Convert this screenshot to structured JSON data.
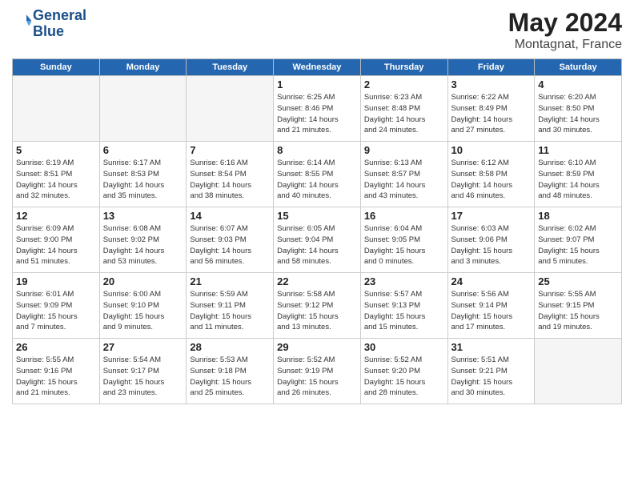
{
  "header": {
    "logo_line1": "General",
    "logo_line2": "Blue",
    "month": "May 2024",
    "location": "Montagnat, France"
  },
  "weekdays": [
    "Sunday",
    "Monday",
    "Tuesday",
    "Wednesday",
    "Thursday",
    "Friday",
    "Saturday"
  ],
  "weeks": [
    [
      {
        "day": "",
        "info": ""
      },
      {
        "day": "",
        "info": ""
      },
      {
        "day": "",
        "info": ""
      },
      {
        "day": "1",
        "info": "Sunrise: 6:25 AM\nSunset: 8:46 PM\nDaylight: 14 hours\nand 21 minutes."
      },
      {
        "day": "2",
        "info": "Sunrise: 6:23 AM\nSunset: 8:48 PM\nDaylight: 14 hours\nand 24 minutes."
      },
      {
        "day": "3",
        "info": "Sunrise: 6:22 AM\nSunset: 8:49 PM\nDaylight: 14 hours\nand 27 minutes."
      },
      {
        "day": "4",
        "info": "Sunrise: 6:20 AM\nSunset: 8:50 PM\nDaylight: 14 hours\nand 30 minutes."
      }
    ],
    [
      {
        "day": "5",
        "info": "Sunrise: 6:19 AM\nSunset: 8:51 PM\nDaylight: 14 hours\nand 32 minutes."
      },
      {
        "day": "6",
        "info": "Sunrise: 6:17 AM\nSunset: 8:53 PM\nDaylight: 14 hours\nand 35 minutes."
      },
      {
        "day": "7",
        "info": "Sunrise: 6:16 AM\nSunset: 8:54 PM\nDaylight: 14 hours\nand 38 minutes."
      },
      {
        "day": "8",
        "info": "Sunrise: 6:14 AM\nSunset: 8:55 PM\nDaylight: 14 hours\nand 40 minutes."
      },
      {
        "day": "9",
        "info": "Sunrise: 6:13 AM\nSunset: 8:57 PM\nDaylight: 14 hours\nand 43 minutes."
      },
      {
        "day": "10",
        "info": "Sunrise: 6:12 AM\nSunset: 8:58 PM\nDaylight: 14 hours\nand 46 minutes."
      },
      {
        "day": "11",
        "info": "Sunrise: 6:10 AM\nSunset: 8:59 PM\nDaylight: 14 hours\nand 48 minutes."
      }
    ],
    [
      {
        "day": "12",
        "info": "Sunrise: 6:09 AM\nSunset: 9:00 PM\nDaylight: 14 hours\nand 51 minutes."
      },
      {
        "day": "13",
        "info": "Sunrise: 6:08 AM\nSunset: 9:02 PM\nDaylight: 14 hours\nand 53 minutes."
      },
      {
        "day": "14",
        "info": "Sunrise: 6:07 AM\nSunset: 9:03 PM\nDaylight: 14 hours\nand 56 minutes."
      },
      {
        "day": "15",
        "info": "Sunrise: 6:05 AM\nSunset: 9:04 PM\nDaylight: 14 hours\nand 58 minutes."
      },
      {
        "day": "16",
        "info": "Sunrise: 6:04 AM\nSunset: 9:05 PM\nDaylight: 15 hours\nand 0 minutes."
      },
      {
        "day": "17",
        "info": "Sunrise: 6:03 AM\nSunset: 9:06 PM\nDaylight: 15 hours\nand 3 minutes."
      },
      {
        "day": "18",
        "info": "Sunrise: 6:02 AM\nSunset: 9:07 PM\nDaylight: 15 hours\nand 5 minutes."
      }
    ],
    [
      {
        "day": "19",
        "info": "Sunrise: 6:01 AM\nSunset: 9:09 PM\nDaylight: 15 hours\nand 7 minutes."
      },
      {
        "day": "20",
        "info": "Sunrise: 6:00 AM\nSunset: 9:10 PM\nDaylight: 15 hours\nand 9 minutes."
      },
      {
        "day": "21",
        "info": "Sunrise: 5:59 AM\nSunset: 9:11 PM\nDaylight: 15 hours\nand 11 minutes."
      },
      {
        "day": "22",
        "info": "Sunrise: 5:58 AM\nSunset: 9:12 PM\nDaylight: 15 hours\nand 13 minutes."
      },
      {
        "day": "23",
        "info": "Sunrise: 5:57 AM\nSunset: 9:13 PM\nDaylight: 15 hours\nand 15 minutes."
      },
      {
        "day": "24",
        "info": "Sunrise: 5:56 AM\nSunset: 9:14 PM\nDaylight: 15 hours\nand 17 minutes."
      },
      {
        "day": "25",
        "info": "Sunrise: 5:55 AM\nSunset: 9:15 PM\nDaylight: 15 hours\nand 19 minutes."
      }
    ],
    [
      {
        "day": "26",
        "info": "Sunrise: 5:55 AM\nSunset: 9:16 PM\nDaylight: 15 hours\nand 21 minutes."
      },
      {
        "day": "27",
        "info": "Sunrise: 5:54 AM\nSunset: 9:17 PM\nDaylight: 15 hours\nand 23 minutes."
      },
      {
        "day": "28",
        "info": "Sunrise: 5:53 AM\nSunset: 9:18 PM\nDaylight: 15 hours\nand 25 minutes."
      },
      {
        "day": "29",
        "info": "Sunrise: 5:52 AM\nSunset: 9:19 PM\nDaylight: 15 hours\nand 26 minutes."
      },
      {
        "day": "30",
        "info": "Sunrise: 5:52 AM\nSunset: 9:20 PM\nDaylight: 15 hours\nand 28 minutes."
      },
      {
        "day": "31",
        "info": "Sunrise: 5:51 AM\nSunset: 9:21 PM\nDaylight: 15 hours\nand 30 minutes."
      },
      {
        "day": "",
        "info": ""
      }
    ]
  ]
}
